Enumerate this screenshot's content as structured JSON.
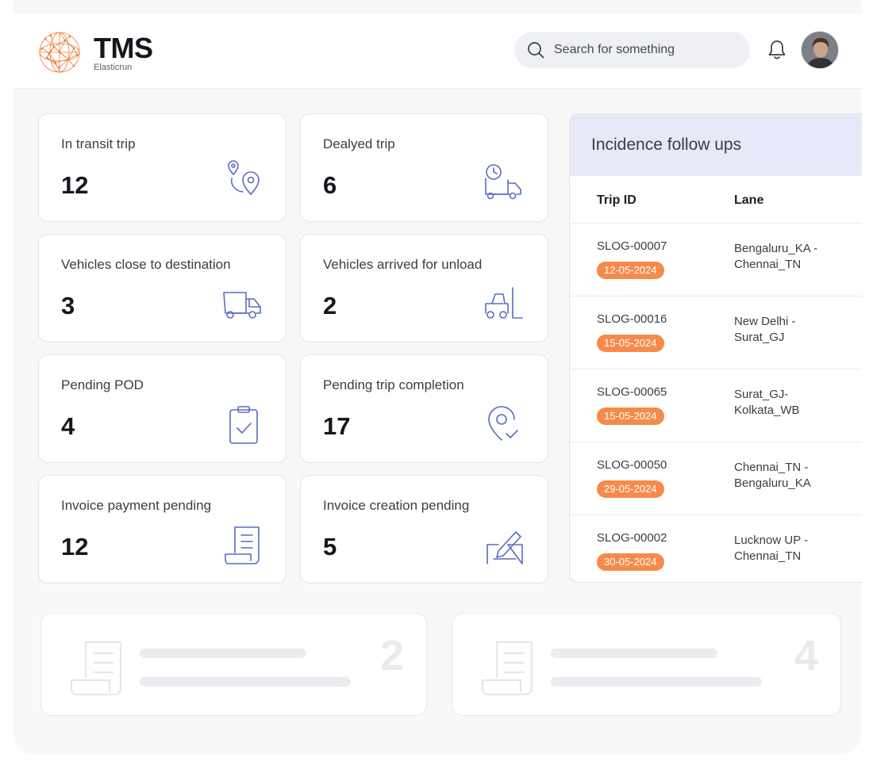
{
  "brand": {
    "title": "TMS",
    "subtitle": "Elasticrun"
  },
  "search": {
    "placeholder": "Search for something"
  },
  "icons": {
    "logo": "globe-network-logo",
    "search": "search-icon",
    "bell": "bell-icon"
  },
  "colors": {
    "accent": "#f58b4b",
    "icon": "#5c6bc0",
    "panel_header": "#e7e9f8"
  },
  "cards": [
    {
      "label": "In transit trip",
      "value": "12",
      "icon": "route-pin-icon"
    },
    {
      "label": "Dealyed trip",
      "value": "6",
      "icon": "delayed-truck-icon"
    },
    {
      "label": "Vehicles close to destination",
      "value": "3",
      "icon": "truck-icon"
    },
    {
      "label": "Vehicles arrived for unload",
      "value": "2",
      "icon": "forklift-icon"
    },
    {
      "label": "Pending POD",
      "value": "4",
      "icon": "clipboard-check-icon"
    },
    {
      "label": "Pending trip completion",
      "value": "17",
      "icon": "location-check-icon"
    },
    {
      "label": "Invoice payment pending",
      "value": "12",
      "icon": "receipt-icon"
    },
    {
      "label": "Invoice creation pending",
      "value": "5",
      "icon": "sign-document-icon"
    }
  ],
  "incidence": {
    "title": "Incidence follow ups",
    "columns": [
      "Trip ID",
      "Lane"
    ],
    "rows": [
      {
        "trip_id": "SLOG-00007",
        "date": "12-05-2024",
        "lane": "Bengaluru_KA - Chennai_TN"
      },
      {
        "trip_id": "SLOG-00016",
        "date": "15-05-2024",
        "lane": "New Delhi - Surat_GJ"
      },
      {
        "trip_id": "SLOG-00065",
        "date": "15-05-2024",
        "lane": "Surat_GJ- Kolkata_WB"
      },
      {
        "trip_id": "SLOG-00050",
        "date": "29-05-2024",
        "lane": "Chennai_TN - Bengaluru_KA"
      },
      {
        "trip_id": "SLOG-00002",
        "date": "30-05-2024",
        "lane": "Lucknow UP - Chennai_TN"
      }
    ]
  },
  "ghost_cards": [
    {
      "number": "2",
      "icon": "receipt-icon"
    },
    {
      "number": "4",
      "icon": "receipt-icon"
    }
  ]
}
